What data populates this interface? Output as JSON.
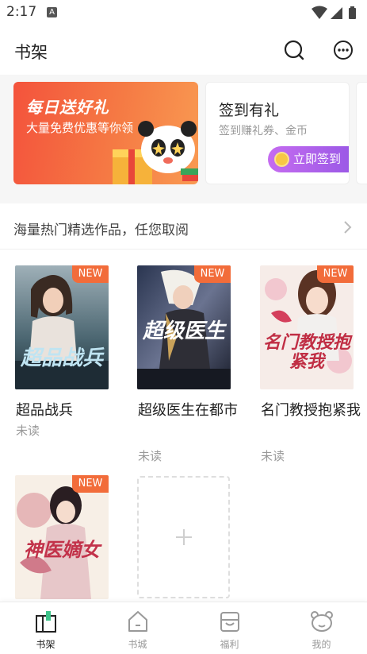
{
  "status_bar": {
    "time": "2:17",
    "notification_glyph": "A"
  },
  "header": {
    "title": "书架",
    "search_icon": "search-icon",
    "more_icon": "more-icon"
  },
  "banners": {
    "promo": {
      "title": "每日送好礼",
      "subtitle": "大量免费优惠等你领"
    },
    "signin": {
      "title": "签到有礼",
      "subtitle": "签到赚礼券、金币",
      "button": "立即签到"
    }
  },
  "recommend": {
    "text": "海量热门精选作品，任您取阅"
  },
  "books": [
    {
      "title": "超品战兵",
      "status": "未读",
      "badge": "NEW",
      "cover_text": "超品战兵"
    },
    {
      "title": "超级医生在都市",
      "status": "未读",
      "badge": "NEW",
      "cover_text": "超级医生"
    },
    {
      "title": "名门教授抱紧我",
      "status": "未读",
      "badge": "NEW",
      "cover_text": "名门教授抱紧我"
    },
    {
      "title": "",
      "status": "",
      "badge": "NEW",
      "cover_text": "神医嫡女"
    }
  ],
  "add_slot": {
    "icon": "plus-icon"
  },
  "bottom_nav": [
    {
      "label": "书架",
      "icon": "bookshelf-icon",
      "active": true
    },
    {
      "label": "书城",
      "icon": "store-icon",
      "active": false
    },
    {
      "label": "福利",
      "icon": "gift-icon",
      "active": false
    },
    {
      "label": "我的",
      "icon": "profile-icon",
      "active": false
    }
  ],
  "colors": {
    "accent": "#f26c3a",
    "promo": "#f4533c",
    "signin_button": "#b063ec",
    "nav_active": "#222222"
  }
}
